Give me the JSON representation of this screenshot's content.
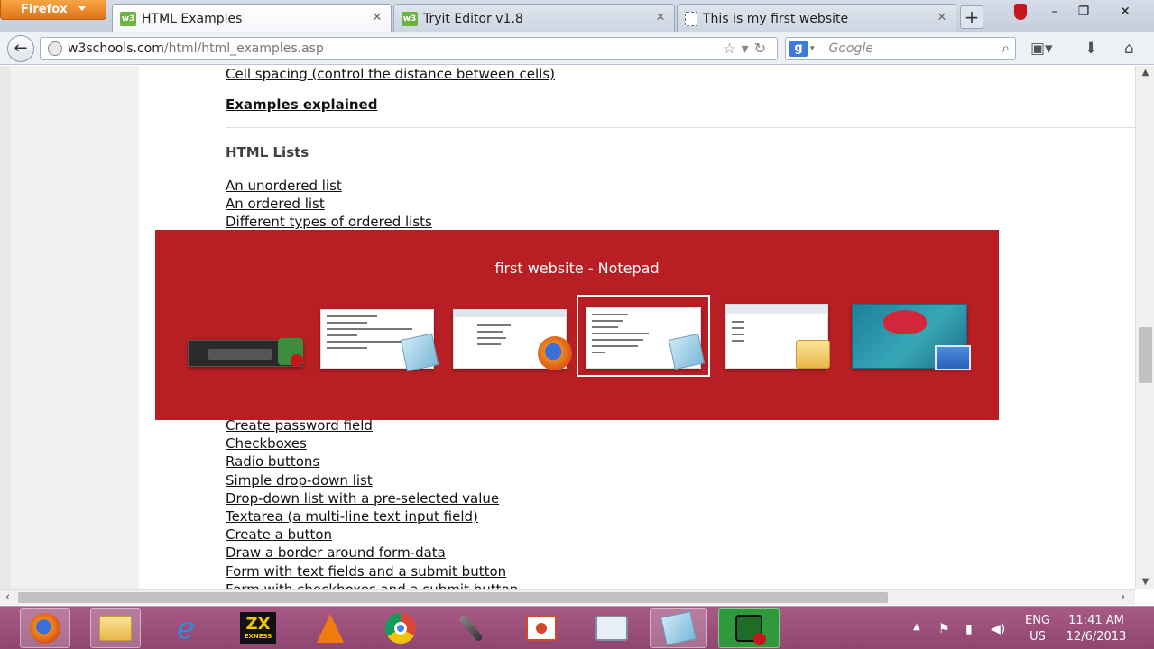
{
  "browser": {
    "menu_button": "Firefox",
    "tabs": [
      {
        "title": "HTML Examples",
        "icon": "w3schools-favicon",
        "active": true
      },
      {
        "title": "Tryit Editor v1.8",
        "icon": "w3schools-favicon",
        "active": false
      },
      {
        "title": "This is my first website",
        "icon": "blank-page-favicon",
        "active": false
      }
    ],
    "url_host": "w3schools.com",
    "url_path": "/html/html_examples.asp",
    "search_engine": "g",
    "search_placeholder": "Google"
  },
  "page": {
    "top_link": "Cell spacing (control the distance between cells)",
    "examples_explained": "Examples explained",
    "lists_heading": "HTML Lists",
    "lists_links": [
      "An unordered list",
      "An ordered list",
      "Different types of ordered lists"
    ],
    "forms_links": [
      "Create password field",
      "Checkboxes",
      "Radio buttons",
      "Simple drop-down list",
      "Drop-down list with a pre-selected value",
      "Textarea (a multi-line text input field)",
      "Create a button",
      "Draw a border around form-data",
      "Form with text fields and a submit button",
      "Form with checkboxes and a submit button"
    ]
  },
  "switcher": {
    "title": "first website - Notepad",
    "accent": "#b81f25",
    "windows": [
      {
        "name": "app-window",
        "icon": "green-app-icon"
      },
      {
        "name": "notepad-list",
        "icon": "notepad-icon"
      },
      {
        "name": "firefox-window",
        "icon": "firefox-icon"
      },
      {
        "name": "notepad-first-website",
        "icon": "notepad-icon",
        "selected": true
      },
      {
        "name": "explorer-window",
        "icon": "folder-icon"
      },
      {
        "name": "desktop",
        "icon": "desktop-icon"
      }
    ]
  },
  "taskbar": {
    "apps": [
      "firefox-icon",
      "file-explorer-icon",
      "internet-explorer-icon",
      "exness-icon",
      "vlc-icon",
      "chrome-icon",
      "microphone-icon",
      "powerpoint-icon",
      "performance-monitor-icon",
      "notepad-icon",
      "green-app-icon"
    ],
    "exness_label": "EXNESS",
    "lang_top": "ENG",
    "lang_bottom": "US",
    "time": "11:41 AM",
    "date": "12/6/2013"
  }
}
